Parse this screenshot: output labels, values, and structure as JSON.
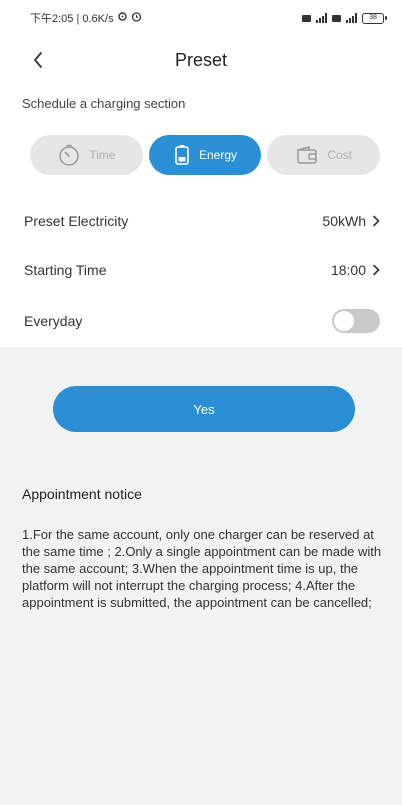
{
  "status_bar": {
    "left_text": "下午2:05 | 0.6K/s",
    "battery": "38"
  },
  "header": {
    "title": "Preset"
  },
  "schedule": {
    "label": "Schedule a charging section",
    "tabs": [
      {
        "label": "Time",
        "icon": "timer-icon",
        "active": false
      },
      {
        "label": "Energy",
        "icon": "battery-icon",
        "active": true
      },
      {
        "label": "Cost",
        "icon": "wallet-icon",
        "active": false
      }
    ]
  },
  "settings": {
    "preset_electricity_label": "Preset Electricity",
    "preset_electricity_value": "50kWh",
    "starting_time_label": "Starting Time",
    "starting_time_value": "18:00",
    "everyday_label": "Everyday",
    "everyday_enabled": false
  },
  "yes_button": {
    "label": "Yes"
  },
  "notice": {
    "title": "Appointment notice",
    "body": "1.For the same account, only one charger can be reserved at the same time ; 2.Only a single appointment can be made with the same account; 3.When the appointment time is up, the platform will not interrupt the charging process; 4.After the appointment is submitted, the appointment can be cancelled;"
  },
  "colors": {
    "accent": "#2a8fd4",
    "background": "#f2f2f2",
    "tab_inactive": "#e6e6e6",
    "toggle_off": "#c9c9c9"
  }
}
